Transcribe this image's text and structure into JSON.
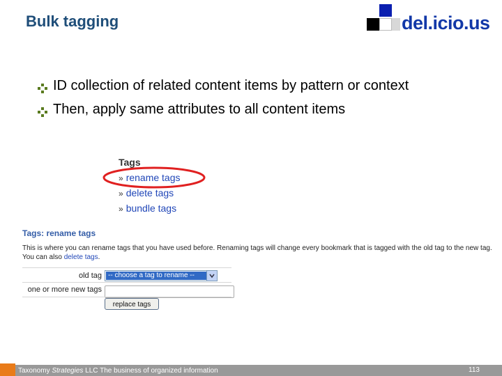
{
  "slide": {
    "title": "Bulk tagging",
    "bullets": [
      "ID collection of related content items by pattern or context",
      "Then, apply same attributes to all content items"
    ]
  },
  "logo": {
    "text": "del.icio.us"
  },
  "tags_menu": {
    "heading": "Tags",
    "items": [
      "rename tags",
      "delete tags",
      "bundle tags"
    ],
    "highlighted_item": "rename tags"
  },
  "rename_panel": {
    "heading": "Tags: rename tags",
    "description": "This is where you can rename tags that you have used before. Renaming tags will change every bookmark that is tagged with the old tag to the new tag. You can also",
    "description_link": "delete tags",
    "description_end": ".",
    "old_tag_label": "old tag",
    "old_tag_value": "-- choose a tag to rename --",
    "new_tags_label": "one or more new tags",
    "new_tags_value": "",
    "submit_label": "replace tags"
  },
  "footer": {
    "company_prefix": "Taxonomy",
    "company_italic": "Strategies",
    "company_suffix": "LLC",
    "tagline": "The business of organized information",
    "page_number": "113"
  },
  "colors": {
    "title": "#1f4e79",
    "logo_blue": "#1238a8",
    "link": "#2147b8",
    "highlight_oval": "#e02020",
    "footer_bar": "#999999",
    "footer_accent": "#e97b19"
  }
}
